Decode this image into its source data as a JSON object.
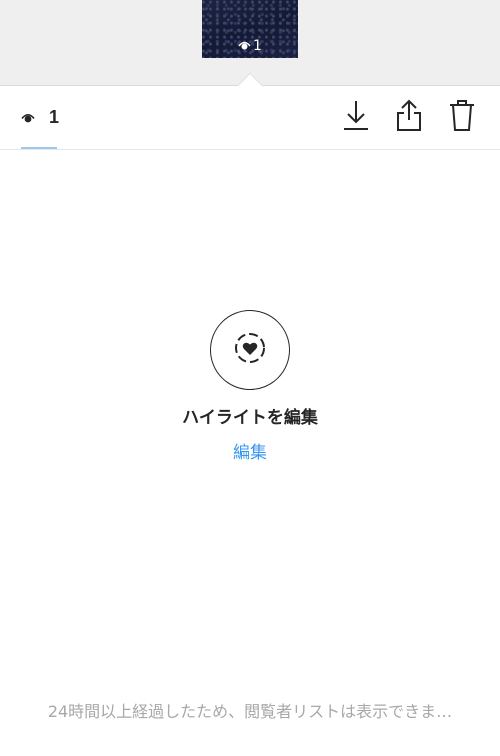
{
  "story": {
    "thumbnail_view_count": "1"
  },
  "toolbar": {
    "viewer_count": "1",
    "icons": [
      "eye-icon",
      "download-icon",
      "share-icon",
      "trash-icon"
    ]
  },
  "empty_state": {
    "title": "ハイライトを編集",
    "edit_link": "編集",
    "icon": "highlight-heart-icon"
  },
  "footer": {
    "note": "24時間以上経過したため、閲覧者リストは表示できま…"
  },
  "colors": {
    "link": "#3897f0",
    "text": "#262626",
    "muted": "#a8a8a8",
    "strip_bg": "#efefef"
  }
}
